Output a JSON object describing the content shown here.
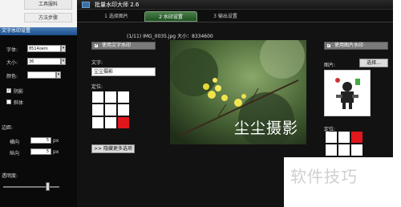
{
  "left_panel": {
    "links": [
      "工具服料",
      "方法步骤"
    ],
    "header": "文字水印设置",
    "font_label": "字体:",
    "font_value": "8514oem",
    "size_label": "大小:",
    "size_value": "36",
    "color_label": "颜色:",
    "shadow_label": "阴影",
    "italic_label": "斜体",
    "margin_label": "边距:",
    "horizontal_label": "横向",
    "horizontal_value": "5",
    "vertical_label": "纵向",
    "vertical_value": "5",
    "unit": "px",
    "opacity_label": "透明度:",
    "opacity_value": 0.8
  },
  "window": {
    "title": "批量水印大师 2.6"
  },
  "tabs": [
    {
      "label": "1 选择图片",
      "active": false
    },
    {
      "label": "2 水印设置",
      "active": true
    },
    {
      "label": "3 输出设置",
      "active": false
    }
  ],
  "text_watermark": {
    "enable_label": "使用文字水印",
    "text_label": "文字:",
    "text_value": "尘尘摄影",
    "position_label": "定位:",
    "more_options_button": ">> 隐藏更多选项"
  },
  "preview": {
    "info": "(1/11)  IMG_0035.jpg  大小：8334600",
    "watermark_text": "尘尘摄影"
  },
  "image_watermark": {
    "enable_label": "使用图片水印",
    "image_label": "图片:",
    "choose_button": "选择...",
    "position_label": "定位:"
  },
  "overlay": {
    "brand": "软件技巧"
  }
}
